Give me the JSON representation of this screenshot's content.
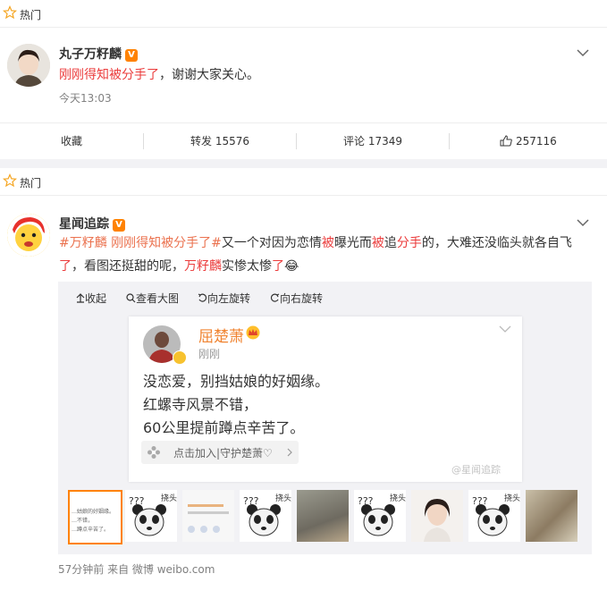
{
  "card1": {
    "hot_label": "热门",
    "username": "丸子万籽麟",
    "verified": "V",
    "post_red": "刚刚得知被分手了",
    "post_rest": "，谢谢大家关心。",
    "time": "今天13:03",
    "actions": {
      "collect": "收藏",
      "repost": "转发 15576",
      "comment": "评论 17349",
      "like": "257116"
    }
  },
  "card2": {
    "hot_label": "热门",
    "username": "星闻追踪",
    "verified": "V",
    "post_parts": [
      {
        "text": "#万籽麟 刚刚得知被分手了#",
        "style": "link"
      },
      {
        "text": "又一个对因为恋情",
        "style": "plain"
      },
      {
        "text": "被",
        "style": "red"
      },
      {
        "text": "曝光而",
        "style": "plain"
      },
      {
        "text": "被",
        "style": "red"
      },
      {
        "text": "追",
        "style": "plain"
      },
      {
        "text": "分手",
        "style": "red"
      },
      {
        "text": "的，大难还没临头就各自飞",
        "style": "plain"
      }
    ],
    "post_line2": [
      {
        "text": "了",
        "style": "red"
      },
      {
        "text": "，看图还挺甜的呢，",
        "style": "plain"
      },
      {
        "text": "万籽麟",
        "style": "red"
      },
      {
        "text": "实惨太惨",
        "style": "plain"
      },
      {
        "text": "了",
        "style": "red"
      }
    ],
    "emoji": "😂",
    "toolbar": {
      "collapse": "收起",
      "view_large": "查看大图",
      "rotate_left": "向左旋转",
      "rotate_right": "向右旋转"
    },
    "embed": {
      "name": "屈楚萧",
      "time": "刚刚",
      "lines": [
        "没恋爱，别挡姑娘的好姻缘。",
        "红螺寺风景不错，",
        "60公里提前蹲点辛苦了。"
      ],
      "join": "点击加入|守护楚萧♡",
      "watermark": "@星闻追踪"
    },
    "thumb_labels": [
      "挠头",
      "挠头",
      "挠头",
      "挠头"
    ],
    "footer": "57分钟前  来自 微博 weibo.com"
  },
  "colors": {
    "accent_orange": "#ff8200",
    "link": "#eb7350",
    "red": "#eb3c3c",
    "selected_border": "#ff8200"
  }
}
